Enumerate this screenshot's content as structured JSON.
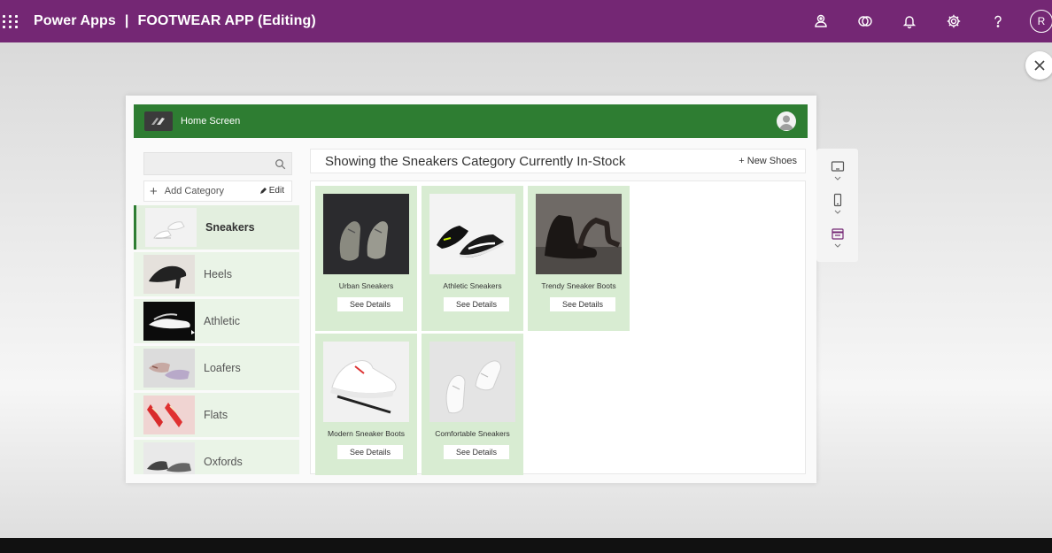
{
  "topbar": {
    "product": "Power Apps",
    "separator": "|",
    "app_name": "FOOTWEAR APP (Editing)",
    "background": "#742774",
    "icons": [
      "environment-icon",
      "copilot-icon",
      "bell-icon",
      "gear-icon",
      "help-icon"
    ],
    "avatar_initial": "R"
  },
  "app": {
    "header_title": "Home Screen",
    "header_color": "#2e7d32",
    "search_placeholder": "",
    "add_category_label": "Add Category",
    "edit_label": "Edit",
    "categories": [
      {
        "label": "Sneakers",
        "selected": true
      },
      {
        "label": "Heels",
        "selected": false
      },
      {
        "label": "Athletic",
        "selected": false
      },
      {
        "label": "Loafers",
        "selected": false
      },
      {
        "label": "Flats",
        "selected": false
      },
      {
        "label": "Oxfords",
        "selected": false
      }
    ],
    "main_title": "Showing the Sneakers Category Currently In-Stock",
    "new_shoes_label": "+ New Shoes",
    "products": [
      {
        "name": "Urban Sneakers",
        "button": "See Details"
      },
      {
        "name": "Athletic Sneakers",
        "button": "See Details"
      },
      {
        "name": "Trendy Sneaker Boots",
        "button": "See Details"
      },
      {
        "name": "Modern Sneaker Boots",
        "button": "See Details"
      },
      {
        "name": "Comfortable Sneakers",
        "button": "See Details"
      }
    ]
  },
  "side_tools": [
    "tablet-layout-icon",
    "phone-layout-icon",
    "calendar-icon"
  ]
}
